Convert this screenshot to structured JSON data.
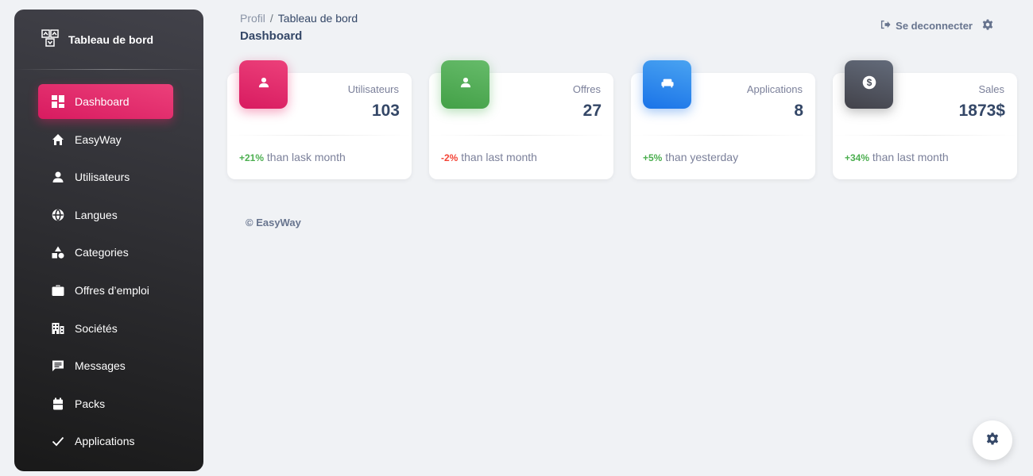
{
  "sidebar": {
    "brand": "Tableau de bord",
    "items": [
      {
        "label": "Dashboard",
        "icon": "dashboard-icon",
        "active": true
      },
      {
        "label": "EasyWay",
        "icon": "home-icon"
      },
      {
        "label": "Utilisateurs",
        "icon": "user-icon"
      },
      {
        "label": "Langues",
        "icon": "globe-icon"
      },
      {
        "label": "Categories",
        "icon": "category-icon"
      },
      {
        "label": "Offres d’emploi",
        "icon": "briefcase-icon"
      },
      {
        "label": "Sociétés",
        "icon": "building-icon"
      },
      {
        "label": "Messages",
        "icon": "message-icon"
      },
      {
        "label": "Packs",
        "icon": "pack-icon"
      },
      {
        "label": "Applications",
        "icon": "check-icon"
      }
    ]
  },
  "header": {
    "breadcrumb_root": "Profil",
    "breadcrumb_sep": "/",
    "breadcrumb_current": "Tableau de bord",
    "title": "Dashboard",
    "logout_label": "Se deconnecter"
  },
  "cards": [
    {
      "label": "Utilisateurs",
      "value": "103",
      "delta": "+21%",
      "delta_text": " than lask month",
      "color": "#e91e63",
      "icon": "person-icon"
    },
    {
      "label": "Offres",
      "value": "27",
      "delta": "-2%",
      "delta_text": " than last month",
      "color": "#4caf50",
      "icon": "person-icon"
    },
    {
      "label": "Applications",
      "value": "8",
      "delta": "+5%",
      "delta_text": " than yesterday",
      "color": "#1a73e8",
      "icon": "sofa-icon"
    },
    {
      "label": "Sales",
      "value": "1873$",
      "delta": "+34%",
      "delta_text": " than last month",
      "color": "#42424a",
      "icon": "dollar-icon"
    }
  ],
  "footer": "© EasyWay",
  "colors": {
    "primary": "#e91e63",
    "success": "#4caf50",
    "info": "#1a73e8",
    "dark": "#42424a",
    "danger": "#f44335"
  }
}
